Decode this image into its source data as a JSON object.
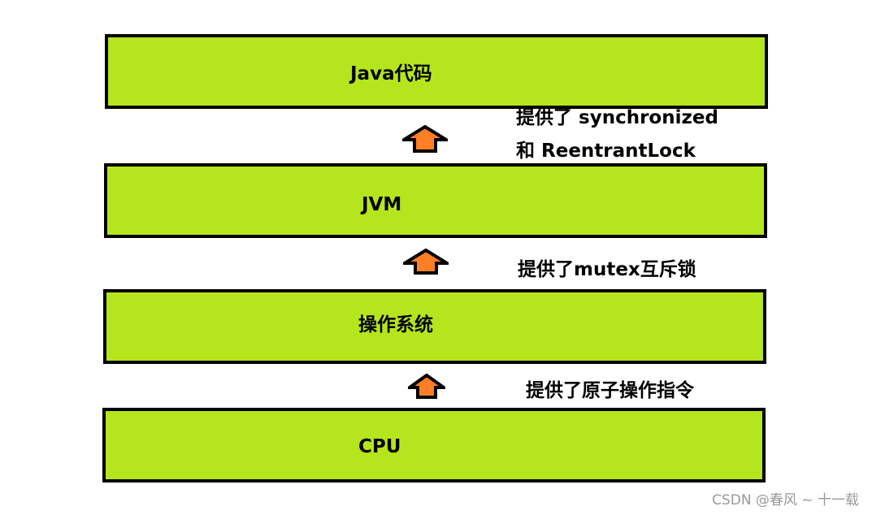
{
  "layers": [
    {
      "id": "java",
      "label": "Java代码"
    },
    {
      "id": "jvm",
      "label": "JVM"
    },
    {
      "id": "os",
      "label": "操作系统"
    },
    {
      "id": "cpu",
      "label": "CPU"
    }
  ],
  "notes": {
    "jvm_to_java_line1": "提供了 synchronized",
    "jvm_to_java_line2": "和 ReentrantLock",
    "os_to_jvm": "提供了mutex互斥锁",
    "cpu_to_os": "提供了原子操作指令"
  },
  "watermark": "CSDN @春风 ~ 十一载",
  "colors": {
    "layer_fill": "#b5e61d",
    "border": "#000000",
    "arrow_fill": "#ff7f27"
  },
  "icons": {
    "arrow": "up-arrow-icon"
  }
}
